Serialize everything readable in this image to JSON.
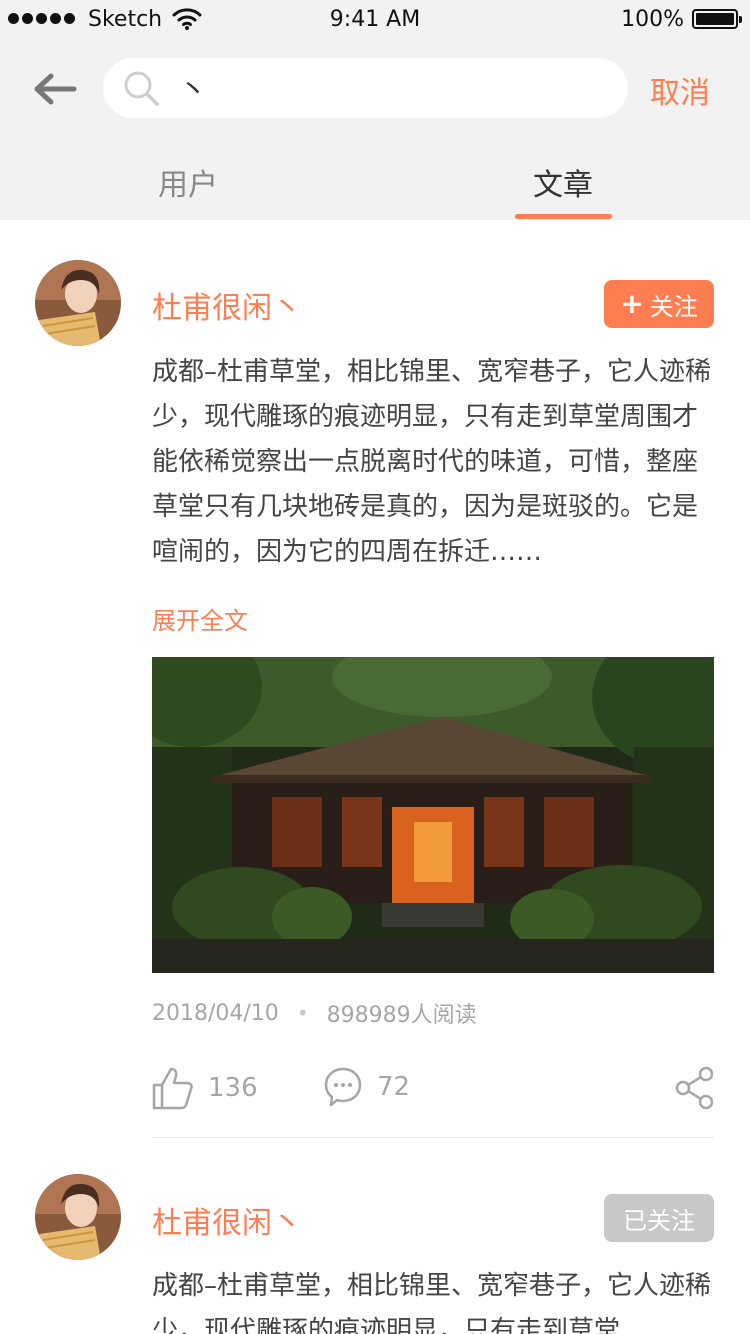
{
  "status_bar": {
    "carrier": "Sketch",
    "time": "9:41 AM",
    "battery": "100%"
  },
  "search": {
    "value": "丶",
    "cancel_label": "取消"
  },
  "tabs": [
    {
      "label": "用户",
      "active": false
    },
    {
      "label": "文章",
      "active": true
    }
  ],
  "posts": [
    {
      "author": "杜甫很闲丶",
      "follow_label": "关注",
      "followed": false,
      "text": "成都–杜甫草堂，相比锦里、宽窄巷子，它人迹稀少，现代雕琢的痕迹明显，只有走到草堂周围才能依稀觉察出一点脱离时代的味道，可惜，整座草堂只有几块地砖是真的，因为是斑驳的。它是喧闹的，因为它的四周在拆迁……",
      "expand_label": "展开全文",
      "date": "2018/04/10",
      "reads": "898989人阅读",
      "likes": "136",
      "comments": "72"
    },
    {
      "author": "杜甫很闲丶",
      "follow_label": "已关注",
      "followed": true,
      "text": "成都–杜甫草堂，相比锦里、宽窄巷子，它人迹稀少，现代雕琢的痕迹明显，只有走到草堂"
    }
  ],
  "colors": {
    "accent": "#ff7e51",
    "header_bg": "#f2f2f2",
    "followed_bg": "#c8c8c8",
    "meta_text": "#a6a6a6"
  },
  "icons": [
    "back-arrow-icon",
    "search-icon",
    "plus-icon",
    "thumbs-up-icon",
    "comment-icon",
    "share-icon",
    "wifi-icon",
    "battery-icon"
  ]
}
